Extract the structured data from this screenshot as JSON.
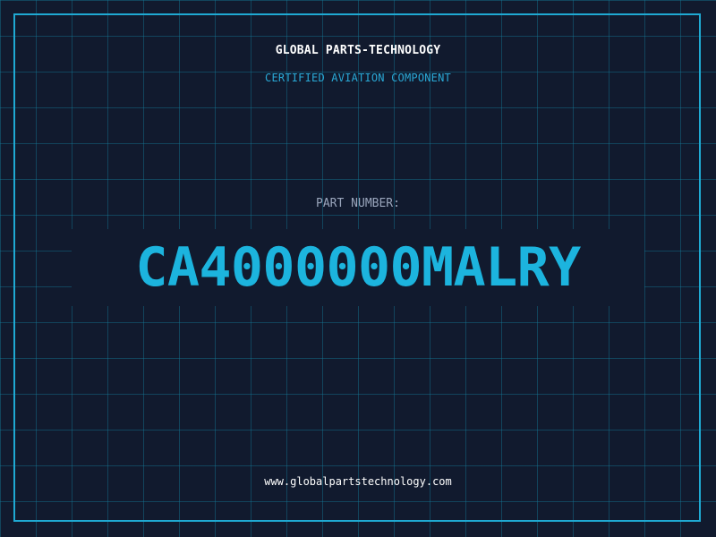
{
  "header": {
    "company": "GLOBAL PARTS-TECHNOLOGY",
    "subtitle": "CERTIFIED AVIATION COMPONENT"
  },
  "part": {
    "label": "PART NUMBER:",
    "number": "CA4000000MALRY"
  },
  "footer": {
    "url": "www.globalpartstechnology.com"
  },
  "colors": {
    "background": "#111a2e",
    "grid": "#14788f",
    "accent": "#1cb4de",
    "frame": "#1fa9d2",
    "label": "#9aa6bc",
    "text": "#ffffff"
  }
}
